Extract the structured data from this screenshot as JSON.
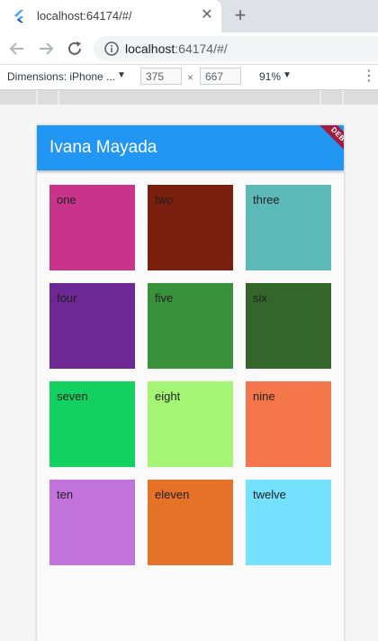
{
  "browser": {
    "tab": {
      "title": "localhost:64174/#/"
    },
    "url": {
      "host": "localhost",
      "rest": ":64174/#/"
    }
  },
  "device_toolbar": {
    "device_label": "Dimensions: iPhone ...",
    "width": "375",
    "height": "667",
    "times": "×",
    "zoom": "91%"
  },
  "app": {
    "title": "Ivana Mayada",
    "banner": "DEBUG"
  },
  "tiles": [
    {
      "label": "one",
      "color": "#c8348a"
    },
    {
      "label": "two",
      "color": "#7b1f0e"
    },
    {
      "label": "three",
      "color": "#5bbab7"
    },
    {
      "label": "four",
      "color": "#6e2896"
    },
    {
      "label": "five",
      "color": "#3a913c"
    },
    {
      "label": "six",
      "color": "#34662b"
    },
    {
      "label": "seven",
      "color": "#13d15f"
    },
    {
      "label": "eight",
      "color": "#a4f574"
    },
    {
      "label": "nine",
      "color": "#f4764a"
    },
    {
      "label": "ten",
      "color": "#c273db"
    },
    {
      "label": "eleven",
      "color": "#e67228"
    },
    {
      "label": "twelve",
      "color": "#74e1fe"
    }
  ]
}
